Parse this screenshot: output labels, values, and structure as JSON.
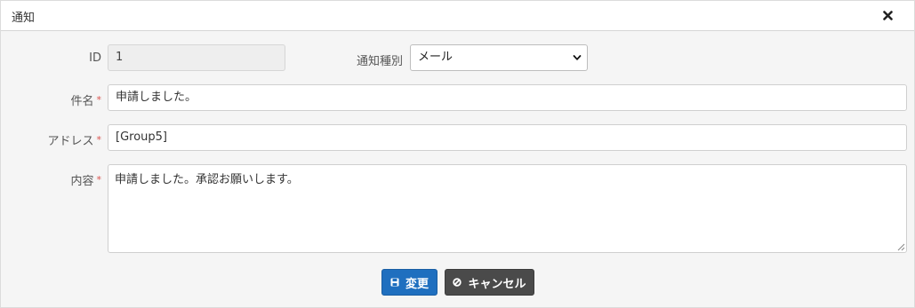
{
  "dialog": {
    "title": "通知"
  },
  "form": {
    "id": {
      "label": "ID",
      "value": "1"
    },
    "type": {
      "label": "通知種別",
      "selected": "メール"
    },
    "subject": {
      "label": "件名",
      "required_mark": "*",
      "value": "申請しました。"
    },
    "address": {
      "label": "アドレス",
      "required_mark": "*",
      "value": "[Group5]"
    },
    "content": {
      "label": "内容",
      "required_mark": "*",
      "value": "申請しました。承認お願いします。"
    }
  },
  "buttons": {
    "save_label": "変更",
    "cancel_label": "キャンセル"
  },
  "colors": {
    "primary": "#1f6fbf",
    "dark": "#4a4a4a",
    "required": "#d9534f"
  }
}
